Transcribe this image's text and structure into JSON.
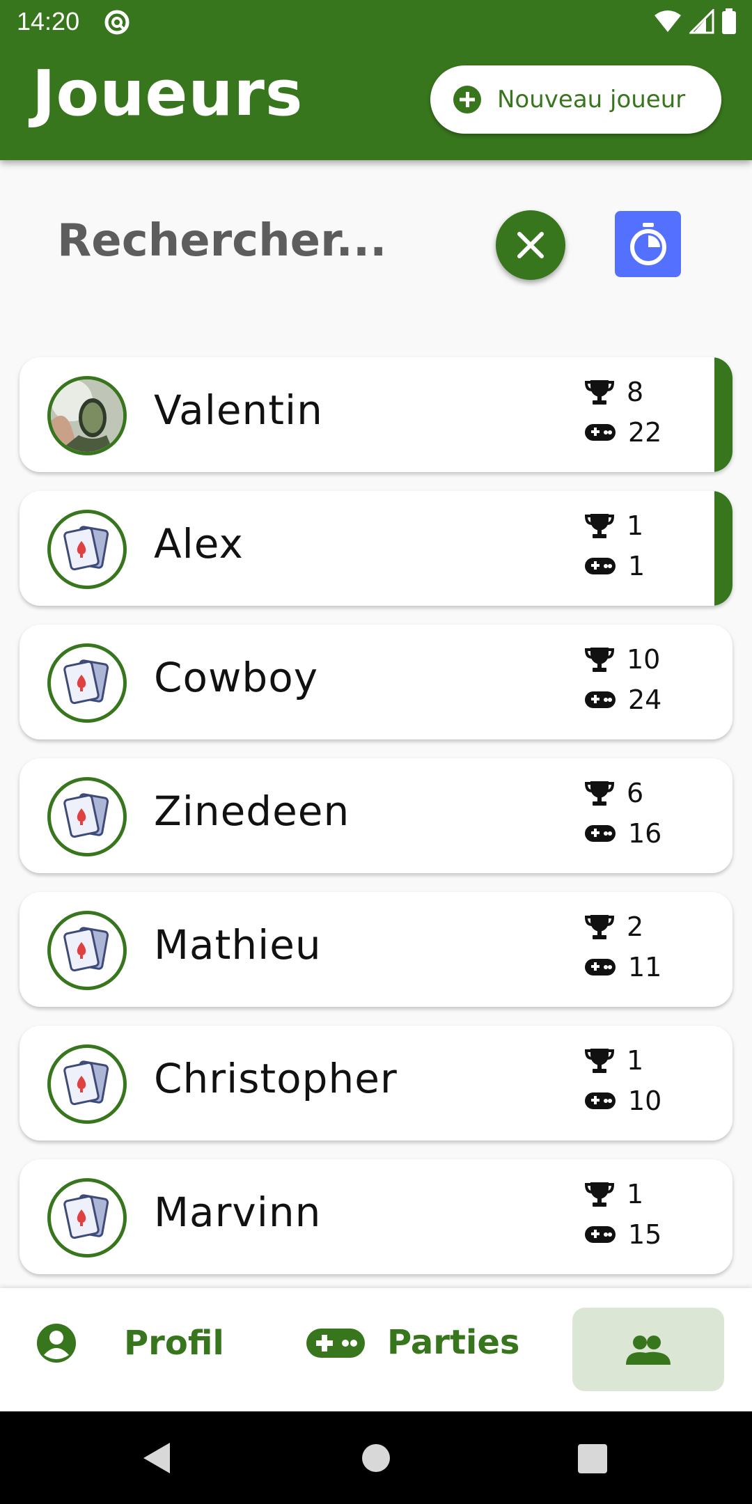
{
  "status_bar": {
    "time": "14:20"
  },
  "header": {
    "title": "Joueurs",
    "new_player_label": "Nouveau joueur"
  },
  "search": {
    "placeholder": "Rechercher..."
  },
  "players": [
    {
      "name": "Valentin",
      "wins": "8",
      "games": "22",
      "active": true,
      "avatar": "photo"
    },
    {
      "name": "Alex",
      "wins": "1",
      "games": "1",
      "active": true,
      "avatar": "cards"
    },
    {
      "name": "Cowboy",
      "wins": "10",
      "games": "24",
      "active": false,
      "avatar": "cards"
    },
    {
      "name": "Zinedeen",
      "wins": "6",
      "games": "16",
      "active": false,
      "avatar": "cards"
    },
    {
      "name": "Mathieu",
      "wins": "2",
      "games": "11",
      "active": false,
      "avatar": "cards"
    },
    {
      "name": "Christopher",
      "wins": "1",
      "games": "10",
      "active": false,
      "avatar": "cards"
    },
    {
      "name": "Marvinn",
      "wins": "1",
      "games": "15",
      "active": false,
      "avatar": "cards"
    }
  ],
  "bottom_nav": {
    "profile_label": "Profil",
    "games_label": "Parties",
    "players_selected": true
  },
  "colors": {
    "primary": "#38761d",
    "timer_button": "#5470ff",
    "nav_selected_bg": "#dbe6d5"
  },
  "icons": {
    "add": "plus-circle-icon",
    "clear": "close-icon",
    "timer": "stopwatch-icon",
    "wins": "trophy-icon",
    "games": "gamepad-icon",
    "profile": "account-circle-icon",
    "players": "group-icon"
  }
}
